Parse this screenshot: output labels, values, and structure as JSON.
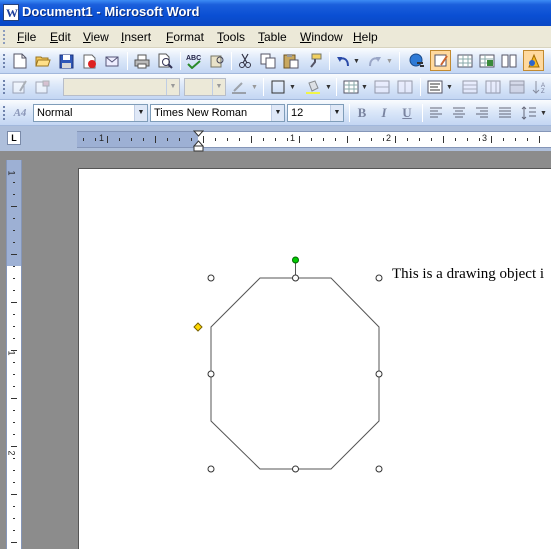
{
  "window": {
    "title": "Document1 - Microsoft Word",
    "app_icon_letter": "W"
  },
  "menu": [
    "File",
    "Edit",
    "View",
    "Insert",
    "Format",
    "Tools",
    "Table",
    "Window",
    "Help"
  ],
  "formatting": {
    "style": "Normal",
    "font": "Times New Roman",
    "size": "12",
    "style_marker": "A4"
  },
  "ruler": {
    "numbers": [
      "1",
      "1",
      "2",
      "3"
    ],
    "vertical_numbers": [
      "1",
      "1",
      "2"
    ],
    "tab_selector": "L"
  },
  "document": {
    "text": "This is a drawing object i"
  },
  "format_buttons": {
    "bold": "B",
    "italic": "I",
    "underline": "U"
  },
  "colors": {
    "titlebar": "#0a4fd3",
    "toolbar": "#dce8f9",
    "rotation_handle": "#00cc00",
    "adjust_handle": "#ffd800",
    "shape_line": "#555555"
  }
}
